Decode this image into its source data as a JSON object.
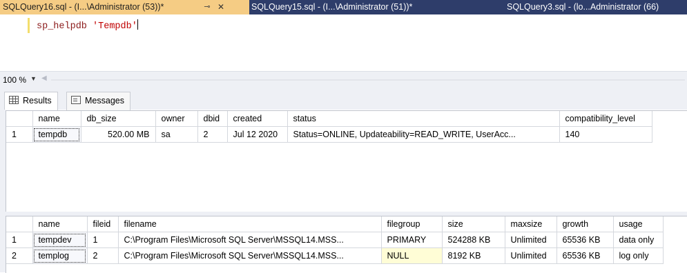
{
  "tabs": [
    {
      "label": "SQLQuery16.sql - (I...\\Administrator (53))*",
      "pin": "⊸",
      "close": "✕"
    },
    {
      "label": "SQLQuery15.sql - (I...\\Administrator (51))*"
    },
    {
      "label": "SQLQuery3.sql - (lo...Administrator (66)"
    }
  ],
  "editor": {
    "keyword": "sp_helpdb",
    "string": "'Tempdb'"
  },
  "zoom": {
    "value": "100 %"
  },
  "result_tabs": {
    "results": "Results",
    "messages": "Messages"
  },
  "grid1": {
    "columns": [
      "",
      "name",
      "db_size",
      "owner",
      "dbid",
      "created",
      "status",
      "compatibility_level"
    ],
    "rows": [
      [
        "1",
        "tempdb",
        "520.00 MB",
        "sa",
        "2",
        "Jul 12 2020",
        "Status=ONLINE, Updateability=READ_WRITE, UserAcc...",
        "140"
      ]
    ]
  },
  "grid2": {
    "columns": [
      "",
      "name",
      "fileid",
      "filename",
      "filegroup",
      "size",
      "maxsize",
      "growth",
      "usage"
    ],
    "rows": [
      [
        "1",
        "tempdev",
        "1",
        "C:\\Program Files\\Microsoft SQL Server\\MSSQL14.MSS...",
        "PRIMARY",
        "524288 KB",
        "Unlimited",
        "65536 KB",
        "data only"
      ],
      [
        "2",
        "templog",
        "2",
        "C:\\Program Files\\Microsoft SQL Server\\MSSQL14.MSS...",
        "NULL",
        "8192 KB",
        "Unlimited",
        "65536 KB",
        "log only"
      ]
    ]
  }
}
